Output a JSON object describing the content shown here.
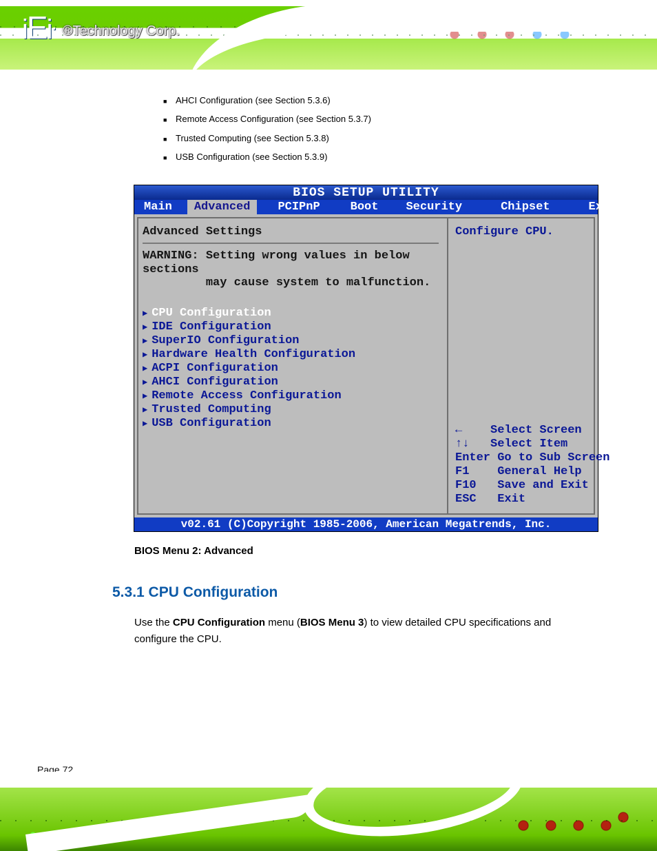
{
  "brand": {
    "trademark": "®Technology Corp."
  },
  "bullets": [
    "AHCI Configuration (see Section 5.3.6)",
    "Remote Access Configuration (see Section 5.3.7)",
    "Trusted Computing (see Section 5.3.8)",
    "USB Configuration (see Section 5.3.9)"
  ],
  "bios": {
    "title": "BIOS SETUP UTILITY",
    "tabs": [
      "Main",
      "Advanced",
      "PCIPnP",
      "Boot",
      "Security",
      "Chipset",
      "Exit"
    ],
    "activeTab": "Advanced",
    "heading": "Advanced Settings",
    "warning_l1": "WARNING: Setting wrong values in below sections",
    "warning_l2": "         may cause system to malfunction.",
    "menu": [
      "CPU Configuration",
      "IDE Configuration",
      "SuperIO Configuration",
      "Hardware Health Configuration",
      "ACPI Configuration",
      "AHCI Configuration",
      "Remote Access Configuration",
      "Trusted Computing",
      "USB Configuration"
    ],
    "selectedMenu": "CPU Configuration",
    "rightHelp": "Configure CPU.",
    "keys": {
      "k0": "←    Select Screen",
      "k1": "↑↓   Select Item",
      "k2": "Enter Go to Sub Screen",
      "k3": "F1    General Help",
      "k4": "F10   Save and Exit",
      "k5": "ESC   Exit"
    },
    "footer": "v02.61 (C)Copyright 1985-2006, American Megatrends, Inc."
  },
  "caption": {
    "label": "BIOS Menu 2: Advanced"
  },
  "section": {
    "title": "5.3.1 CPU Configuration",
    "p1a": "Use the ",
    "p1b": "CPU Configuration",
    "p1c": " menu (",
    "p1d": "BIOS Menu 3",
    "p1e": ") to view detailed CPU specifications and configure the CPU."
  },
  "pageNumber": "Page 72"
}
